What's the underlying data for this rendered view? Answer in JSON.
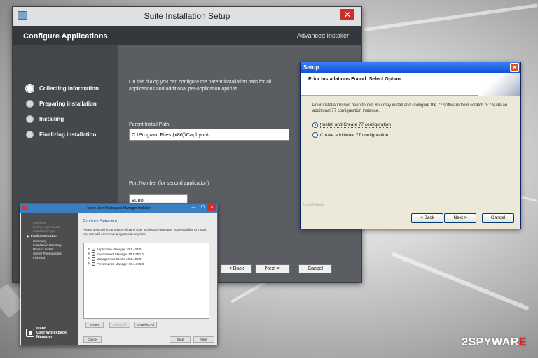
{
  "suite": {
    "title": "Suite Installation Setup",
    "close": "✕",
    "header": "Configure Applications",
    "brand": "Advanced Installer",
    "steps": [
      {
        "label": "Collecting information"
      },
      {
        "label": "Preparing installation"
      },
      {
        "label": "Installing"
      },
      {
        "label": "Finalizing installation"
      }
    ],
    "intro": "On this dialog you can configure the parent installation path for all applications and additional per-application options.",
    "path_label": "Parent Install Path:",
    "path_value": "C:\\Program Files (x86)\\Caphyon\\",
    "port_label": "Port Number (for second application)",
    "port_value": "8080",
    "back": "< Back",
    "next": "Next >",
    "cancel": "Cancel"
  },
  "setup": {
    "title": "Setup",
    "close": "✕",
    "heading": "Prior Installations Found: Select Option",
    "description": "Prior installation has been found. You may install and configure the 77 software from scratch or create an additional 77 configuration instance.",
    "options": [
      {
        "label": "Install and Create 77 configuration",
        "selected": true
      },
      {
        "label": "Create additional 77 configuration",
        "selected": false
      }
    ],
    "installscript": "InstallShield",
    "back": "< Back",
    "next": "Next >",
    "cancel": "Cancel"
  },
  "ivanti": {
    "title": "Ivanti User Workspace Manager Installer",
    "minimize": "—",
    "maximize": "☐",
    "close": "✕",
    "nav": [
      {
        "label": "Welcome",
        "state": "dim"
      },
      {
        "label": "License Agreement",
        "state": "dim"
      },
      {
        "label": "Installation Type",
        "state": "dim"
      },
      {
        "label": "Product Selection",
        "state": "current"
      },
      {
        "label": "Summary",
        "state": "normal"
      },
      {
        "label": "Installation Directory",
        "state": "normal"
      },
      {
        "label": "Product Install",
        "state": "normal"
      },
      {
        "label": "Server Prerequisites",
        "state": "normal"
      },
      {
        "label": "Finished",
        "state": "normal"
      }
    ],
    "logo_line1": "ivanti",
    "logo_line2": "User Workspace",
    "logo_line3": "Manager",
    "page_title": "Product Selection",
    "page_desc": "Please select which products of Ivanti User Workspace Manager you would like to install. You can add or remove programs at any time.",
    "products": [
      {
        "label": "Application Manager 10.1.423.0"
      },
      {
        "label": "Environment Manager 10.1.550.0"
      },
      {
        "label": "Management Center 10.1.400.0"
      },
      {
        "label": "Performance Manager 10.1.370.0"
      }
    ],
    "reset": "Reset",
    "select_all": "Select All",
    "unselect_all": "Unselect All",
    "cancel": "Cancel",
    "back": "Back",
    "next": "Next"
  },
  "watermark": {
    "prefix": "2SPYWAR",
    "suffix": "E"
  }
}
